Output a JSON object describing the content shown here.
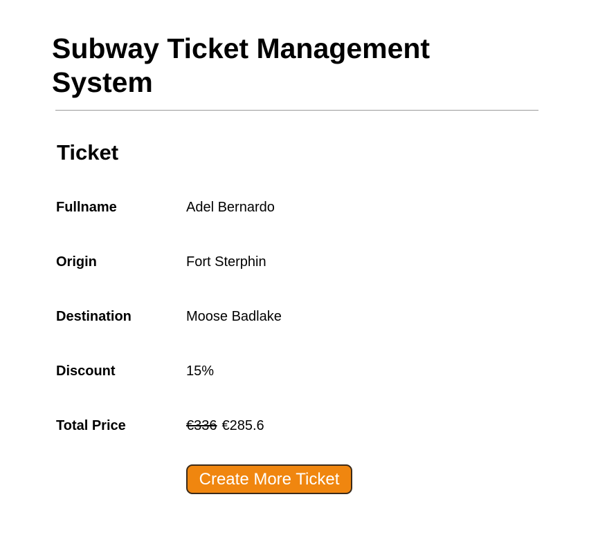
{
  "header": {
    "title": "Subway Ticket Management System"
  },
  "ticket": {
    "heading": "Ticket",
    "fields": [
      {
        "label": "Fullname",
        "value": "Adel Bernardo"
      },
      {
        "label": "Origin",
        "value": "Fort Sterphin"
      },
      {
        "label": "Destination",
        "value": "Moose Badlake"
      },
      {
        "label": "Discount",
        "value": "15%"
      }
    ],
    "total_price": {
      "label": "Total Price",
      "original": "€336",
      "discounted": "€285.6"
    }
  },
  "actions": {
    "create_more_label": "Create More Ticket",
    "button_color": "#f0860f"
  }
}
